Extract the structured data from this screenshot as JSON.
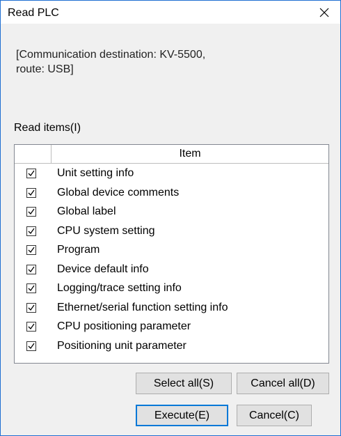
{
  "window": {
    "title": "Read PLC"
  },
  "destination_text": "[Communication destination: KV-5500,\nroute: USB]",
  "read_items_label": "Read items(I)",
  "list": {
    "header_item": "Item",
    "items": [
      {
        "label": "Unit setting info",
        "checked": true
      },
      {
        "label": "Global device comments",
        "checked": true
      },
      {
        "label": "Global label",
        "checked": true
      },
      {
        "label": "CPU system setting",
        "checked": true
      },
      {
        "label": "Program",
        "checked": true
      },
      {
        "label": "Device default info",
        "checked": true
      },
      {
        "label": "Logging/trace setting info",
        "checked": true
      },
      {
        "label": "Ethernet/serial function setting info",
        "checked": true
      },
      {
        "label": "CPU positioning parameter",
        "checked": true
      },
      {
        "label": "Positioning unit parameter",
        "checked": true
      }
    ]
  },
  "buttons": {
    "select_all": "Select all(S)",
    "cancel_all": "Cancel all(D)",
    "execute": "Execute(E)",
    "cancel": "Cancel(C)"
  },
  "icons": {
    "close": "close-icon",
    "checkbox": "checkmark-icon"
  },
  "colors": {
    "window_border": "#1f6fd2",
    "default_button_border": "#0078d7"
  }
}
